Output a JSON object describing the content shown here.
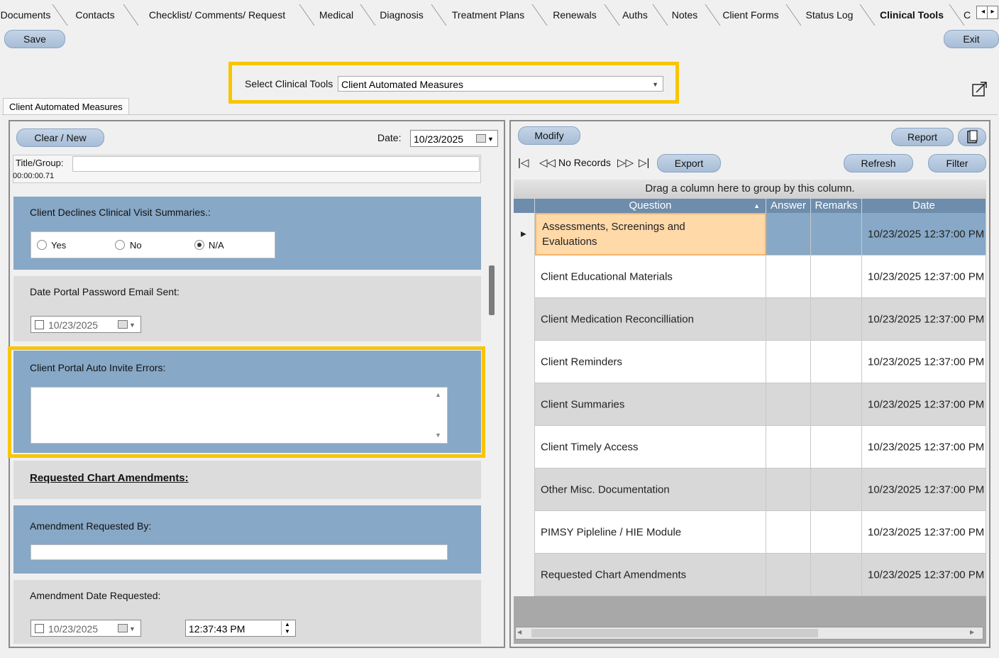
{
  "tabs": [
    "Documents",
    "Contacts",
    "Checklist/ Comments/ Request",
    "Medical",
    "Diagnosis",
    "Treatment Plans",
    "Renewals",
    "Auths",
    "Notes",
    "Client Forms",
    "Status Log",
    "Clinical Tools",
    "C"
  ],
  "active_tab": "Clinical Tools",
  "toolbar": {
    "save_label": "Save",
    "exit_label": "Exit"
  },
  "selector": {
    "label": "Select Clinical Tools",
    "value": "Client Automated Measures"
  },
  "sub_tab": "Client Automated Measures",
  "left": {
    "clear_new_label": "Clear / New",
    "date_label": "Date:",
    "date_value": "10/23/2025",
    "title_group_label": "Title/Group:",
    "title_group_value": "",
    "timer": "00:00:00.71",
    "sections": {
      "declines": {
        "label": "Client Declines Clinical Visit Summaries.:",
        "options": [
          "Yes",
          "No",
          "N/A"
        ],
        "selected": "N/A"
      },
      "portal_email": {
        "label": "Date Portal Password Email Sent:",
        "date": "10/23/2025",
        "checked": false
      },
      "auto_invite": {
        "label": "Client Portal Auto Invite Errors:",
        "value": ""
      },
      "amendments_header": {
        "label": "Requested Chart Amendments:"
      },
      "requested_by": {
        "label": "Amendment Requested By:",
        "value": ""
      },
      "date_requested": {
        "label": "Amendment Date Requested:",
        "date": "10/23/2025",
        "time": "12:37:43 PM",
        "checked": false
      }
    }
  },
  "right": {
    "modify_label": "Modify",
    "report_label": "Report",
    "nav_status": "No Records",
    "export_label": "Export",
    "refresh_label": "Refresh",
    "filter_label": "Filter",
    "group_hint": "Drag a column here to group by this column.",
    "columns": [
      "Question",
      "Answer",
      "Remarks",
      "Date"
    ],
    "rows": [
      {
        "question": "Assessments, Screenings and",
        "question2": "Evaluations",
        "answer": "",
        "remarks": "",
        "date": "10/23/2025 12:37:00 PM"
      },
      {
        "question": "Client Educational Materials",
        "question2": "",
        "answer": "",
        "remarks": "",
        "date": "10/23/2025 12:37:00 PM"
      },
      {
        "question": "Client Medication Reconcilliation",
        "question2": "",
        "answer": "",
        "remarks": "",
        "date": "10/23/2025 12:37:00 PM"
      },
      {
        "question": "Client Reminders",
        "question2": "",
        "answer": "",
        "remarks": "",
        "date": "10/23/2025 12:37:00 PM"
      },
      {
        "question": "Client Summaries",
        "question2": "",
        "answer": "",
        "remarks": "",
        "date": "10/23/2025 12:37:00 PM"
      },
      {
        "question": "Client Timely Access",
        "question2": "",
        "answer": "",
        "remarks": "",
        "date": "10/23/2025 12:37:00 PM"
      },
      {
        "question": "Other Misc. Documentation",
        "question2": "",
        "answer": "",
        "remarks": "",
        "date": "10/23/2025 12:37:00 PM"
      },
      {
        "question": "PIMSY Pipleline / HIE Module",
        "question2": "",
        "answer": "",
        "remarks": "",
        "date": "10/23/2025 12:37:00 PM"
      },
      {
        "question": "Requested Chart Amendments",
        "question2": "",
        "answer": "",
        "remarks": "",
        "date": "10/23/2025 12:37:00 PM"
      }
    ]
  },
  "colors": {
    "highlight": "#f8c600",
    "section_blue": "#87a8c6",
    "section_gray": "#dcdcdc",
    "selected_row": "#ffd9a8",
    "header_blue": "#6e8cab"
  }
}
